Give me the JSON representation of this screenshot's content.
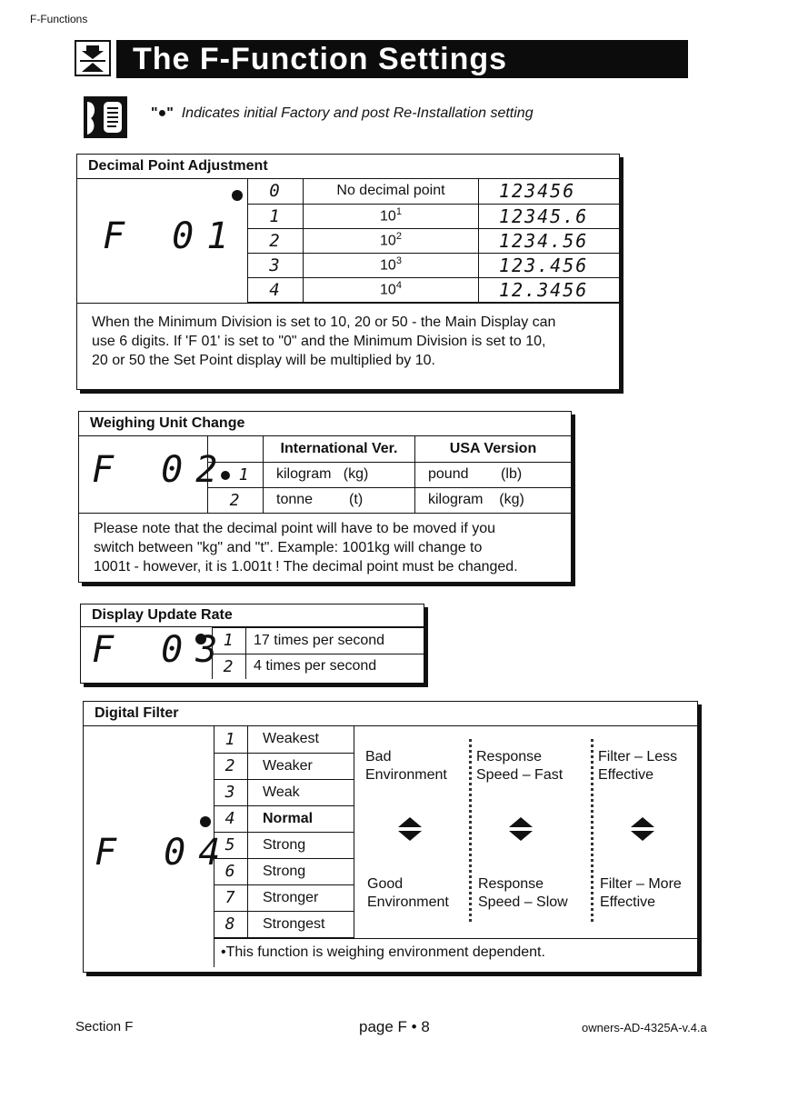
{
  "header": {
    "section_label": "F-Functions"
  },
  "title": {
    "text": "The F-Function Settings",
    "icon": "zero-tracking-icon"
  },
  "note": {
    "bullet": "\"●\"",
    "text": "Indicates initial Factory and post Re-Installation setting",
    "icon": "notebook-speech-icon"
  },
  "f01": {
    "title": "Decimal Point Adjustment",
    "code": "F 01",
    "default_option": "0",
    "rows": [
      {
        "option": "0",
        "label": "No decimal point",
        "display": "123456",
        "default": true
      },
      {
        "option": "1",
        "label": "10",
        "exp": "1",
        "display": "12345.6",
        "default": false
      },
      {
        "option": "2",
        "label": "10",
        "exp": "2",
        "display": "1234.56",
        "default": false
      },
      {
        "option": "3",
        "label": "10",
        "exp": "3",
        "display": "123.456",
        "default": false
      },
      {
        "option": "4",
        "label": "10",
        "exp": "4",
        "display": "12.3456",
        "default": false
      }
    ],
    "note_lines": [
      "When the Minimum Division is set to 10, 20 or 50 - the Main Display can",
      "use 6 digits.  If  'F 01' is set to \"0\" and the Minimum Division is set to 10,",
      "20 or 50 the Set Point display will be multiplied by 10."
    ]
  },
  "f02": {
    "title": "Weighing Unit Change",
    "code": "F 02",
    "col_headers": [
      "International Ver.",
      "USA Version"
    ],
    "rows": [
      {
        "option": "1",
        "default": true,
        "intl": "kilogram   (kg)",
        "usa": "pound        (lb)"
      },
      {
        "option": "2",
        "default": false,
        "intl": "tonne         (t)",
        "usa": "kilogram    (kg)"
      }
    ],
    "note_lines": [
      "Please note that the decimal point will have to be moved if you",
      "switch between \"kg\" and \"t\".  Example: 1001kg will change to",
      "1001t - however, it is 1.001t ! The decimal point must be changed."
    ]
  },
  "f03": {
    "title": "Display  Update   Rate",
    "code": "F 03",
    "rows": [
      {
        "option": "1",
        "label": "17 times per second",
        "default": true
      },
      {
        "option": "2",
        "label": "4 times per second",
        "default": false
      }
    ]
  },
  "f04": {
    "title": "Digital  Filter",
    "code": "F 04",
    "rows": [
      {
        "option": "1",
        "label": "Weakest",
        "default": false
      },
      {
        "option": "2",
        "label": "Weaker",
        "default": false
      },
      {
        "option": "3",
        "label": "Weak",
        "default": false
      },
      {
        "option": "4",
        "label": "Normal",
        "default": true
      },
      {
        "option": "5",
        "label": "Strong",
        "default": false
      },
      {
        "option": "6",
        "label": "Strong",
        "default": false
      },
      {
        "option": "7",
        "label": "Stronger",
        "default": false
      },
      {
        "option": "8",
        "label": "Strongest",
        "default": false
      }
    ],
    "scales": [
      {
        "top": [
          "Bad",
          "Environment"
        ],
        "bottom": [
          "Good",
          "Environment"
        ]
      },
      {
        "top": [
          "Response",
          "Speed – Fast"
        ],
        "bottom": [
          "Response",
          "Speed – Slow"
        ]
      },
      {
        "top": [
          "Filter – Less",
          "Effective"
        ],
        "bottom": [
          "Filter – More",
          "Effective"
        ]
      }
    ],
    "footnote": "•This function is weighing environment dependent."
  },
  "footer": {
    "left": "Section F",
    "center": "page F • 8",
    "right": "owners-AD-4325A-v.4.a"
  }
}
